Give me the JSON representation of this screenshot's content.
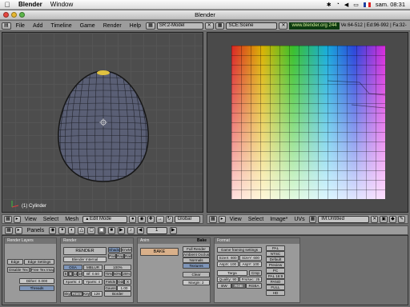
{
  "mac_menubar": {
    "apple_icon": "apple-logo-icon",
    "items": [
      "Blender",
      "Window"
    ],
    "clock": "sam. 08:31",
    "status_icons": [
      "bluetooth-icon",
      "wifi-icon",
      "volume-icon",
      "battery-icon",
      "flag-fr-icon"
    ]
  },
  "window": {
    "title": "Blender"
  },
  "header": {
    "menus": [
      "File",
      "Add",
      "Timeline",
      "Game",
      "Render",
      "Help"
    ],
    "screen": "SR:2-Model",
    "scene": "SCE:Scene",
    "link": "www.blender.org 244",
    "stats": "Ve:64-512 | Ed:96-992 | Fa:32-"
  },
  "view3d": {
    "object_label": "(1) Cylinder",
    "menus": [
      "View",
      "Select",
      "Mesh"
    ],
    "mode": "Edit Mode",
    "orientation": "Global",
    "layer": "1"
  },
  "image_editor": {
    "menus": [
      "View",
      "Select",
      "Image*",
      "UVs"
    ],
    "image_name": "IM:Untitled"
  },
  "buttons_header": {
    "panels_label": "Panels",
    "frame": "1"
  },
  "panels": {
    "render_layers": {
      "title": "Render Layers",
      "edge": "Edge",
      "edge_settings": "Edge Settings",
      "disable_tex": "Disable Tex",
      "free_tex_images": "Free Tex Images",
      "dither": "Dither: 0.000",
      "threads": "Threads"
    },
    "render": {
      "title": "Render",
      "render_btn": "RENDER",
      "engine": "Blender Internal",
      "osa": "OSA",
      "mblur": "MBLUR",
      "osa_vals": [
        "5",
        "8",
        "11",
        "16"
      ],
      "bf": "Bf: 0.50",
      "percents": [
        "100%",
        "75%",
        "50%",
        "25%"
      ],
      "xparts": "Xparts: 4",
      "yparts": "Yparts: 4",
      "fields": "Fields",
      "odd": "Odd",
      "x": "X",
      "gauss": "Gauss",
      "gauss_val": "1.00",
      "sky": "Sky",
      "premul": "Premul",
      "key": "Key",
      "bits": "128",
      "shadow": "Shadow",
      "envmap": "EnvMap",
      "pano": "Pano",
      "ray": "Ray",
      "radio": "Radio",
      "border": "Border"
    },
    "bake": {
      "title": "Bake",
      "tab": "Anim",
      "bake_btn": "BAKE",
      "full_render": "Full Render",
      "ambient_occlusion": "Ambient Occlusion",
      "normals": "Normals",
      "textures": "Textures",
      "clear": "Clear",
      "margin": "Margin: 2"
    },
    "format": {
      "title": "Format",
      "game_framing": "Game framing settings",
      "size_x": "SizeX: 800",
      "size_y": "SizeY: 600",
      "asp_x": "AspX: 100",
      "asp_y": "AspY: 100",
      "format": "Targa",
      "crop": "Crop",
      "quality": "Quality: 90",
      "frs_sec": "Frs/sec: 25",
      "bw": "BW",
      "rgb": "RGB",
      "rgba": "RGBA",
      "presets": [
        "PAL",
        "NTSC",
        "Default",
        "Preview",
        "PC",
        "PAL 16:9",
        "PANO",
        "FULL",
        "HD"
      ]
    }
  },
  "colors": {
    "bg": "#6c6c6c",
    "header": "#9c9c9c",
    "viewport": "#4d4d4d",
    "mesh": "#5a5f75",
    "selected_verts": "#e0c240",
    "link_bg": "#0c3a10"
  }
}
